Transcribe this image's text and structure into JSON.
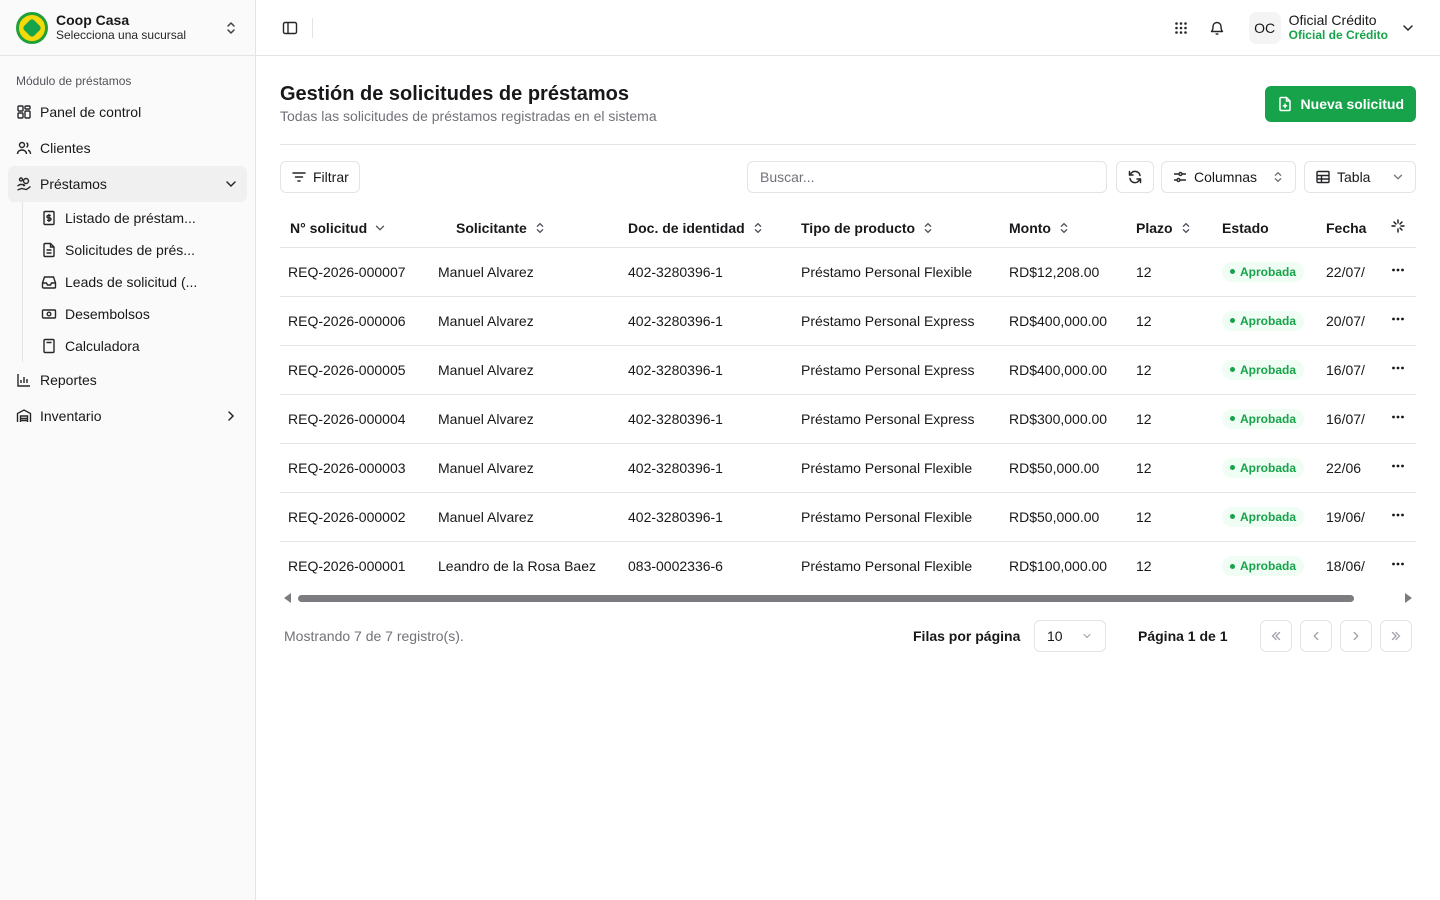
{
  "brand": {
    "name": "Coop Casa",
    "subtitle": "Selecciona una sucursal"
  },
  "sidebar": {
    "section_label": "Módulo de préstamos",
    "items": [
      {
        "label": "Panel de control",
        "icon": "grid-icon"
      },
      {
        "label": "Clientes",
        "icon": "users-icon"
      },
      {
        "label": "Préstamos",
        "icon": "hand-coins-icon",
        "expanded": true
      },
      {
        "label": "Reportes",
        "icon": "bar-chart-icon"
      },
      {
        "label": "Inventario",
        "icon": "warehouse-icon"
      }
    ],
    "sub_items": [
      {
        "label": "Listado de préstam...",
        "icon": "receipt-icon"
      },
      {
        "label": "Solicitudes de prés...",
        "icon": "file-text-icon"
      },
      {
        "label": "Leads de solicitud (...",
        "icon": "inbox-icon"
      },
      {
        "label": "Desembolsos",
        "icon": "banknote-icon"
      },
      {
        "label": "Calculadora",
        "icon": "calculator-icon"
      }
    ]
  },
  "topbar": {
    "user_initials": "OC",
    "user_name": "Oficial Crédito",
    "user_role": "Oficial de Crédito"
  },
  "page": {
    "title": "Gestión de solicitudes de préstamos",
    "subtitle": "Todas las solicitudes de préstamos registradas en el sistema",
    "new_button": "Nueva solicitud"
  },
  "toolbar": {
    "filter_label": "Filtrar",
    "search_placeholder": "Buscar...",
    "columns_label": "Columnas",
    "view_label": "Tabla"
  },
  "table": {
    "headers": [
      "N° solicitud",
      "Solicitante",
      "Doc. de identidad",
      "Tipo de producto",
      "Monto",
      "Plazo",
      "Estado",
      "Fecha"
    ],
    "rows": [
      {
        "id": "REQ-2026-000007",
        "applicant": "Manuel Alvarez",
        "doc": "402-3280396-1",
        "product": "Préstamo Personal Flexible",
        "amount": "RD$12,208.00",
        "term": "12",
        "status": "Aprobada",
        "date": "22/07/"
      },
      {
        "id": "REQ-2026-000006",
        "applicant": "Manuel Alvarez",
        "doc": "402-3280396-1",
        "product": "Préstamo Personal Express",
        "amount": "RD$400,000.00",
        "term": "12",
        "status": "Aprobada",
        "date": "20/07/"
      },
      {
        "id": "REQ-2026-000005",
        "applicant": "Manuel Alvarez",
        "doc": "402-3280396-1",
        "product": "Préstamo Personal Express",
        "amount": "RD$400,000.00",
        "term": "12",
        "status": "Aprobada",
        "date": "16/07/"
      },
      {
        "id": "REQ-2026-000004",
        "applicant": "Manuel Alvarez",
        "doc": "402-3280396-1",
        "product": "Préstamo Personal Express",
        "amount": "RD$300,000.00",
        "term": "12",
        "status": "Aprobada",
        "date": "16/07/"
      },
      {
        "id": "REQ-2026-000003",
        "applicant": "Manuel Alvarez",
        "doc": "402-3280396-1",
        "product": "Préstamo Personal Flexible",
        "amount": "RD$50,000.00",
        "term": "12",
        "status": "Aprobada",
        "date": "22/06"
      },
      {
        "id": "REQ-2026-000002",
        "applicant": "Manuel Alvarez",
        "doc": "402-3280396-1",
        "product": "Préstamo Personal Flexible",
        "amount": "RD$50,000.00",
        "term": "12",
        "status": "Aprobada",
        "date": "19/06/"
      },
      {
        "id": "REQ-2026-000001",
        "applicant": "Leandro de la Rosa Baez",
        "doc": "083-0002336-6",
        "product": "Préstamo Personal Flexible",
        "amount": "RD$100,000.00",
        "term": "12",
        "status": "Aprobada",
        "date": "18/06/"
      }
    ]
  },
  "footer": {
    "showing": "Mostrando 7 de 7 registro(s).",
    "rows_per_page_label": "Filas por página",
    "rows_per_page_value": "10",
    "page_info": "Página 1 de 1"
  },
  "colors": {
    "accent": "#16a34a",
    "status_bg": "#f0fdf4",
    "border": "#e4e4e7"
  }
}
